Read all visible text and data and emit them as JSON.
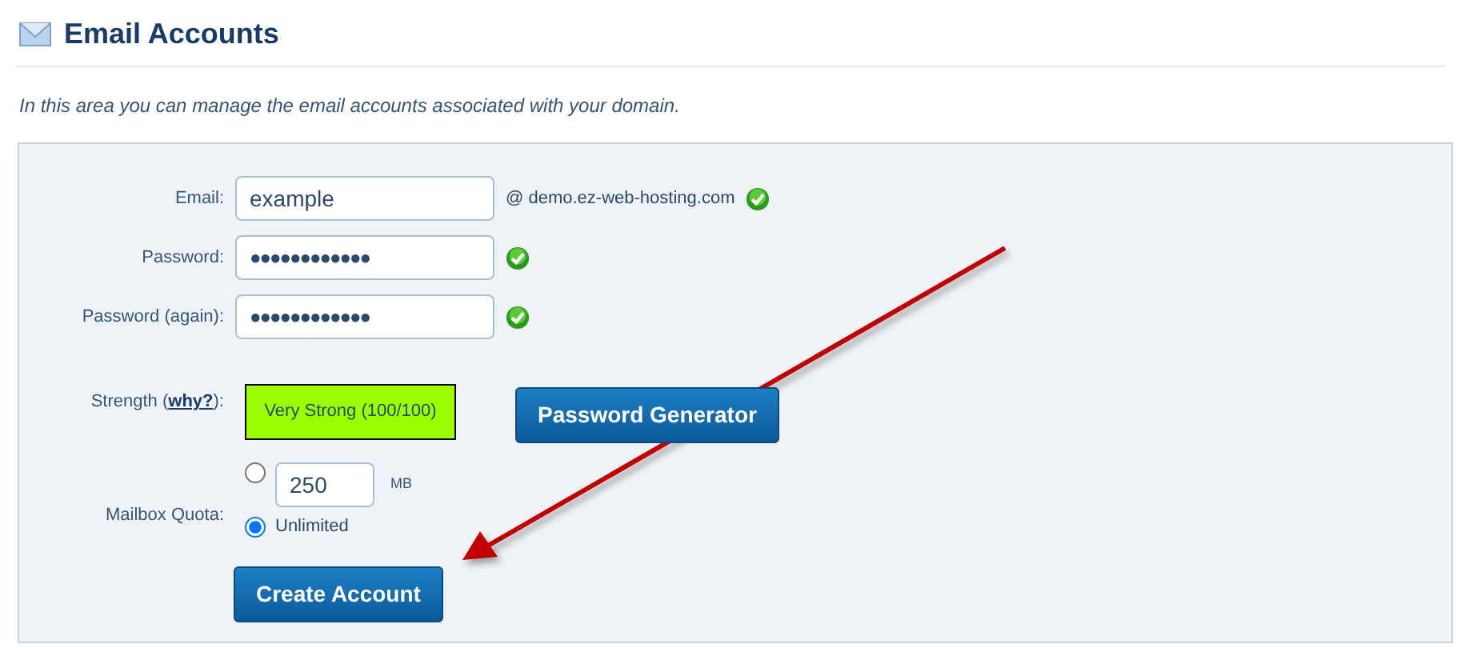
{
  "header": {
    "title": "Email Accounts"
  },
  "intro": "In this area you can manage the email accounts associated with your domain.",
  "form": {
    "email": {
      "label": "Email:",
      "value": "example",
      "domain": "@ demo.ez-web-hosting.com",
      "valid": true
    },
    "password": {
      "label": "Password:",
      "value": "●●●●●●●●●●●●",
      "valid": true
    },
    "password_again": {
      "label": "Password (again):",
      "value": "●●●●●●●●●●●●",
      "valid": true
    },
    "strength": {
      "label_prefix": "Strength (",
      "link": "why?",
      "label_suffix": "):",
      "reading": "Very Strong (100/100)",
      "color": "#99ff00"
    },
    "generator_button": "Password Generator",
    "quota": {
      "label": "Mailbox Quota:",
      "options": [
        {
          "kind": "amount",
          "value": "250",
          "unit": "MB",
          "selected": false
        },
        {
          "kind": "unlimited",
          "label": "Unlimited",
          "selected": true
        }
      ]
    },
    "submit_button": "Create Account"
  },
  "annotation": {
    "kind": "arrow"
  }
}
